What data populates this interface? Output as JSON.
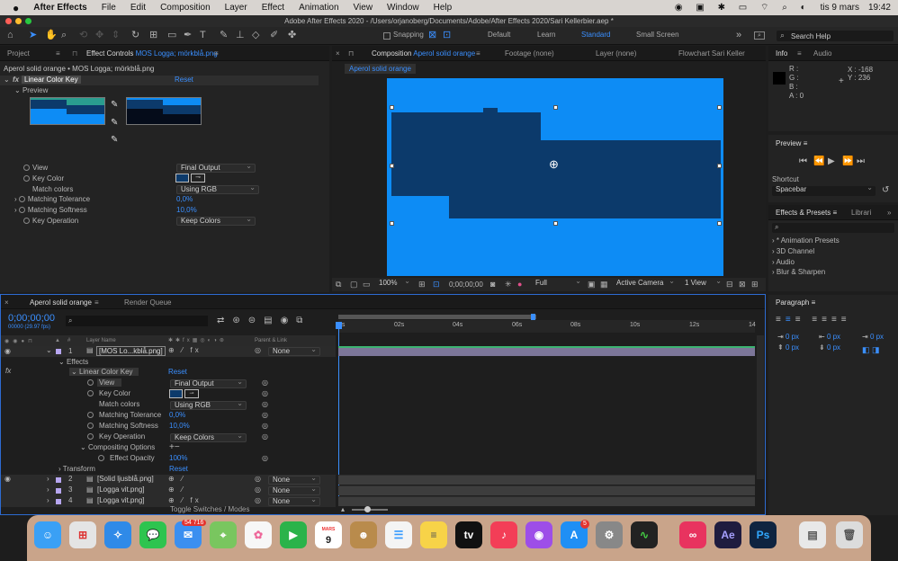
{
  "menubar": {
    "apple": "",
    "app": "After Effects",
    "items": [
      "File",
      "Edit",
      "Composition",
      "Layer",
      "Effect",
      "Animation",
      "View",
      "Window",
      "Help"
    ],
    "date": "tis 9 mars",
    "time": "19:42"
  },
  "titlebar": {
    "title": "Adobe After Effects 2020 - /Users/orjanoberg/Documents/Adobe/After Effects 2020/Sari Kellerbier.aep *"
  },
  "toolbar": {
    "snapping": "Snapping",
    "workspaces": [
      "Default",
      "Learn",
      "Standard",
      "Small Screen"
    ],
    "active_workspace": "Standard",
    "search_placeholder": "Search Help"
  },
  "project_panel": {
    "tab_project": "Project",
    "tab_effect_controls": "Effect Controls",
    "ec_target": "MOS Logga; mörkblå.png",
    "breadcrumb": "Aperol solid orange • MOS Logga; mörkblå.png",
    "effect_name": "Linear Color Key",
    "reset": "Reset",
    "preview_label": "Preview",
    "props": [
      {
        "label": "View",
        "value": "Final Output"
      },
      {
        "label": "Key Color",
        "value": ""
      },
      {
        "label": "Match colors",
        "value": "Using RGB"
      },
      {
        "label": "Matching Tolerance",
        "value": "0,0%"
      },
      {
        "label": "Matching Softness",
        "value": "10,0%"
      },
      {
        "label": "Key Operation",
        "value": "Keep Colors"
      }
    ]
  },
  "comp_panel": {
    "tab_label": "Composition",
    "comp_name": "Aperol solid orange",
    "footage_tab": "Footage (none)",
    "layer_tab": "Layer (none)",
    "flowchart_tab": "Flowchart Sari Keller",
    "sub_tab": "Aperol solid orange",
    "zoom": "100%",
    "timecode": "0;00;00;00",
    "resolution": "Full",
    "camera": "Active Camera",
    "views": "1 View"
  },
  "info_panel": {
    "tab_info": "Info",
    "tab_audio": "Audio",
    "r": "R :",
    "g": "G :",
    "b": "B :",
    "a": "A :  0",
    "x": "X : -168",
    "y": "Y : 236"
  },
  "preview_panel": {
    "title": "Preview",
    "shortcut_label": "Shortcut",
    "shortcut_value": "Spacebar"
  },
  "effects_presets": {
    "title": "Effects & Presets",
    "librari": "Librari",
    "items": [
      "* Animation Presets",
      "3D Channel",
      "Audio",
      "Blur & Sharpen"
    ]
  },
  "paragraph_panel": {
    "title": "Paragraph",
    "fields": [
      "0 px",
      "0 px",
      "0 px",
      "0 px",
      "0 px"
    ]
  },
  "timeline": {
    "tab": "Aperol solid orange",
    "render_queue": "Render Queue",
    "timecode": "0;00;00;00",
    "fps": "00000 (29.97 fps)",
    "col_num": "#",
    "col_layer": "Layer Name",
    "col_parent": "Parent & Link",
    "ruler": [
      "0s",
      "02s",
      "04s",
      "06s",
      "08s",
      "10s",
      "12s",
      "14"
    ],
    "toggle_label": "Toggle Switches / Modes",
    "layer1": {
      "num": "1",
      "name": "[MOS Lo...kblå.png]",
      "parent": "None"
    },
    "effects_label": "Effects",
    "effect_name": "Linear Color Key",
    "reset": "Reset",
    "props": [
      {
        "label": "View",
        "value": "Final Output"
      },
      {
        "label": "Key Color",
        "value": ""
      },
      {
        "label": "Match colors",
        "value": "Using RGB"
      },
      {
        "label": "Matching Tolerance",
        "value": "0,0%"
      },
      {
        "label": "Matching Softness",
        "value": "10,0%"
      },
      {
        "label": "Key Operation",
        "value": "Keep Colors"
      }
    ],
    "compositing_options": "Compositing Options",
    "effect_opacity_label": "Effect Opacity",
    "effect_opacity": "100%",
    "transform": "Transform",
    "transform_reset": "Reset",
    "other_layers": [
      {
        "num": "2",
        "name": "[Solid ljusblå.png]",
        "parent": "None"
      },
      {
        "num": "3",
        "name": "[Logga vit.png]",
        "parent": "None"
      },
      {
        "num": "4",
        "name": "[Logga vit.png]",
        "parent": "None"
      }
    ]
  },
  "dock": {
    "mail_badge": "54 716",
    "appstore_badge": "5",
    "calendar_month": "MARS",
    "calendar_day": "9"
  },
  "colors": {
    "accent": "#2d8cff",
    "comp_bg": "#0d8cf5",
    "logo": "#0c3a6b"
  }
}
